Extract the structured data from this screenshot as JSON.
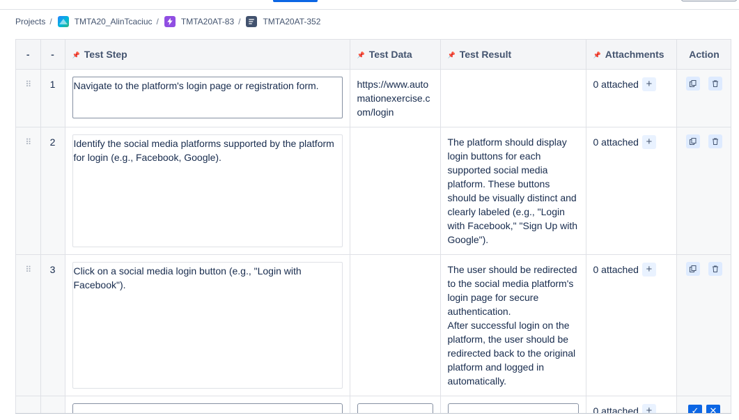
{
  "breadcrumb": {
    "root": "Projects",
    "project": "TMTA20_AlinTcaciuc",
    "epic": "TMTA20AT-83",
    "issue": "TMTA20AT-352",
    "separator": "/"
  },
  "table": {
    "headers": {
      "handle": "-",
      "number": "-",
      "step": "Test Step",
      "data": "Test Data",
      "result": "Test Result",
      "attachments": "Attachments",
      "action": "Action"
    },
    "rows": [
      {
        "number": "1",
        "step": "Navigate to the platform's login page or registration form.",
        "data": "https://www.automationexercise.com/login",
        "result": "",
        "attachments": "0 attached"
      },
      {
        "number": "2",
        "step": "Identify the social media platforms supported by the platform for login (e.g., Facebook, Google).",
        "data": "",
        "result": "The platform should display login buttons for each supported social media platform. These buttons should be visually distinct and clearly labeled (e.g., \"Login with Facebook,\" \"Sign Up with Google\").",
        "attachments": "0 attached"
      },
      {
        "number": "3",
        "step": "Click on a social media login button (e.g., \"Login with Facebook\").",
        "data": "",
        "result": "The user should be redirected to the social media platform's login page for secure authentication.\nAfter successful login on the platform, the user should be redirected back to the original platform and logged in automatically.",
        "attachments": "0 attached"
      }
    ],
    "new_row": {
      "attachments": "0 attached"
    }
  },
  "icons": {
    "drag": "drag-handle-icon",
    "pin": "pin-icon",
    "plus": "plus-icon",
    "clone": "clone-icon",
    "delete": "trash-icon",
    "confirm": "check-icon",
    "cancel": "close-icon"
  },
  "colors": {
    "accent": "#0c66e4",
    "epic": "#904ee2",
    "header_bg": "#f4f5f7"
  }
}
